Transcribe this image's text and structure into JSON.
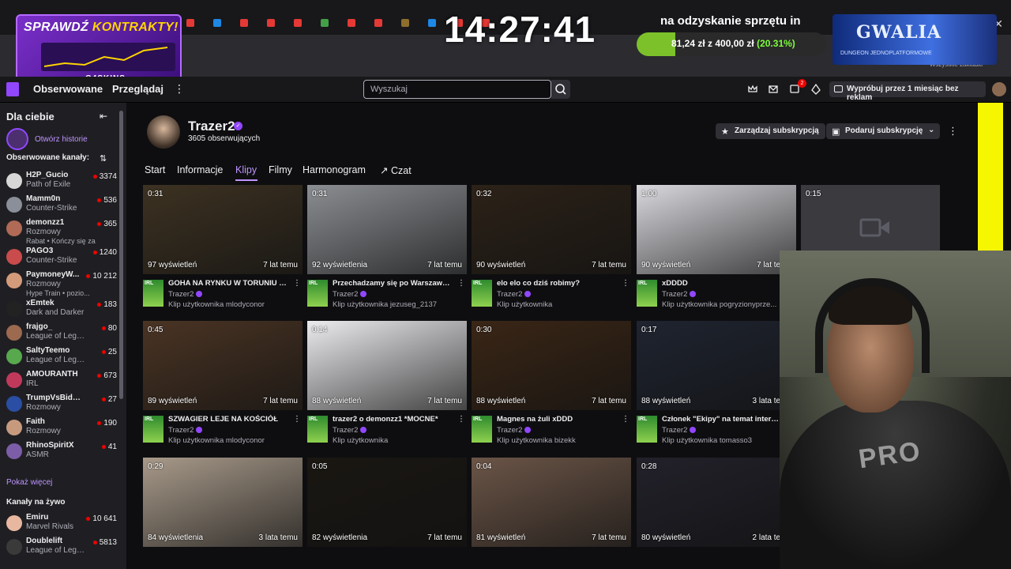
{
  "browser": {
    "bookmarks_label": "Wszystkie zakładki",
    "tabs": [
      {
        "color": "#e53935"
      },
      {
        "color": "#1e88e5"
      },
      {
        "color": "#e53935"
      },
      {
        "color": "#e53935"
      },
      {
        "color": "#e53935"
      },
      {
        "color": "#43a047"
      },
      {
        "color": "#e53935"
      },
      {
        "color": "#e53935"
      },
      {
        "color": "#8e6e2c"
      },
      {
        "color": "#1e88e5"
      },
      {
        "color": "#e53935"
      },
      {
        "color": "#e53935"
      }
    ]
  },
  "overlay": {
    "promo": {
      "title_a": "SPRAWDŹ",
      "title_b": "KONTRAKTY!",
      "brand": "G4SKINS"
    },
    "clock": "14:27:41",
    "goal": {
      "title": "na odzyskanie sprzętu in",
      "text": "81,24 zł z 400,00 zł",
      "pct": "(20.31%)",
      "fraction": 0.2031
    },
    "gwalia": {
      "title": "GWALIA",
      "subtitle": "DUNGEON JEDNOPLATFORMOWE"
    },
    "webcam_shirt": "PRO"
  },
  "nav": {
    "following": "Obserwowane",
    "browse": "Przeglądaj",
    "search_placeholder": "Wyszukaj",
    "notification_count": "2",
    "try_ad_free": "Wypróbuj przez 1 miesiąc bez reklam"
  },
  "sidebar": {
    "header": "Dla ciebie",
    "open_history": "Otwórz historie",
    "followed_label": "Obserwowane kanały:",
    "live_label": "Kanały na żywo",
    "show_more": "Pokaż więcej",
    "followed": [
      {
        "name": "H2P_Gucio",
        "game": "Path of Exile",
        "viewers": "3374",
        "color": "#d7d7d7"
      },
      {
        "name": "Mamm0n",
        "game": "Counter-Strike",
        "viewers": "536",
        "color": "#8a8f99"
      },
      {
        "name": "demonzz1",
        "game": "Rozmowy",
        "viewers": "365",
        "color": "#b06a55",
        "extra": "Rabat • Kończy się za"
      },
      {
        "name": "PAGO3",
        "game": "Counter-Strike",
        "viewers": "1240",
        "color": "#c94b4b"
      },
      {
        "name": "PaymoneyW...",
        "game": "Rozmowy",
        "viewers": "10 212",
        "color": "#d49b7a",
        "extra": "Hype Train • pozio..."
      },
      {
        "name": "xEmtek",
        "game": "Dark and Darker",
        "viewers": "183",
        "color": "#222222"
      },
      {
        "name": "frajgo_",
        "game": "League of Lege...",
        "viewers": "80",
        "color": "#9b6a4f"
      },
      {
        "name": "SaltyTeemo",
        "game": "League of Lege...",
        "viewers": "25",
        "color": "#58a84e"
      },
      {
        "name": "AMOURANTH",
        "game": "IRL",
        "viewers": "673",
        "color": "#c0395b"
      },
      {
        "name": "TrumpVsBiden2...",
        "game": "Rozmowy",
        "viewers": "27",
        "color": "#2a4ea3"
      },
      {
        "name": "Faith",
        "game": "Rozmowy",
        "viewers": "190",
        "color": "#c79a7e"
      },
      {
        "name": "RhinoSpiritX",
        "game": "ASMR",
        "viewers": "41",
        "color": "#7b5ea7"
      }
    ],
    "live": [
      {
        "name": "Emiru",
        "game": "Marvel Rivals",
        "viewers": "10 641",
        "color": "#e8b7a0"
      },
      {
        "name": "Doublelift",
        "game": "League of Lege...",
        "viewers": "5813",
        "color": "#3a3a3a"
      }
    ]
  },
  "channel": {
    "name": "Trazer2",
    "followers": "3605 obserwujących",
    "manage_sub": "Zarządzaj subskrypcją",
    "gift_sub": "Podaruj subskrypcję",
    "tabs": [
      "Start",
      "Informacje",
      "Klipy",
      "Filmy",
      "Harmonogram",
      "Czat"
    ],
    "active_tab": "Klipy"
  },
  "clips": [
    {
      "duration": "0:31",
      "views": "97 wyświetleń",
      "age": "7 lat temu",
      "title": "GOHA NA RYNKU W TORUNIU P...",
      "author": "Trazer2",
      "by": "Klip użytkownika mlodyconor",
      "thumb": "#3d3222"
    },
    {
      "duration": "0:31",
      "views": "92 wyświetlenia",
      "age": "7 lat temu",
      "title": "Przechadzamy się po Warszaws...",
      "author": "Trazer2",
      "by": "Klip użytkownika jezuseg_2137",
      "thumb": "#8b8e92"
    },
    {
      "duration": "0:32",
      "views": "90 wyświetleń",
      "age": "7 lat temu",
      "title": "elo elo co dziś robimy?",
      "author": "Trazer2",
      "by": "Klip użytkownika",
      "thumb": "#2c2218"
    },
    {
      "duration": "1:00",
      "views": "90 wyświetleń",
      "age": "7 lat temu",
      "title": "xDDDD",
      "author": "Trazer2",
      "by": "Klip użytkownika pogryzionyprze...",
      "thumb": "#d9d9de"
    },
    {
      "duration": "0:45",
      "views": "89 wyświetleń",
      "age": "7 lat temu",
      "title": "SZWAGIER LEJE NA KOŚCIÓŁ",
      "author": "Trazer2",
      "by": "Klip użytkownika mlodyconor",
      "thumb": "#4a3424"
    },
    {
      "duration": "0:14",
      "views": "88 wyświetleń",
      "age": "7 lat temu",
      "title": "trazer2 o demonzz1 *MOCNE*",
      "author": "Trazer2",
      "by": "Klip użytkownika",
      "thumb": "#ececef"
    },
    {
      "duration": "0:30",
      "views": "88 wyświetleń",
      "age": "7 lat temu",
      "title": "Magnes na żuli xDDD",
      "author": "Trazer2",
      "by": "Klip użytkownika bizekk",
      "thumb": "#3a2616"
    },
    {
      "duration": "0:17",
      "views": "88 wyświetleń",
      "age": "3 lata temu",
      "title": "Członek \"Ekipy\" na temat intern...",
      "author": "Trazer2",
      "by": "Klip użytkownika tomasso3",
      "thumb": "#1f2430"
    },
    {
      "duration": "0:29",
      "views": "84 wyświetlenia",
      "age": "3 lata temu",
      "title": "",
      "author": "",
      "by": "",
      "thumb": "#a89a8a"
    },
    {
      "duration": "0:05",
      "views": "82 wyświetlenia",
      "age": "7 lat temu",
      "title": "",
      "author": "",
      "by": "",
      "thumb": "#1a1712"
    },
    {
      "duration": "0:04",
      "views": "81 wyświetleń",
      "age": "7 lat temu",
      "title": "",
      "author": "",
      "by": "",
      "thumb": "#6b5547"
    },
    {
      "duration": "0:28",
      "views": "80 wyświetleń",
      "age": "2 lata temu",
      "title": "",
      "author": "",
      "by": "",
      "thumb": "#22212a"
    }
  ],
  "extra_clip": {
    "duration": "0:15"
  },
  "colors": {
    "accent": "#9147ff",
    "accent_text": "#bf94ff",
    "live": "#eb0400"
  }
}
